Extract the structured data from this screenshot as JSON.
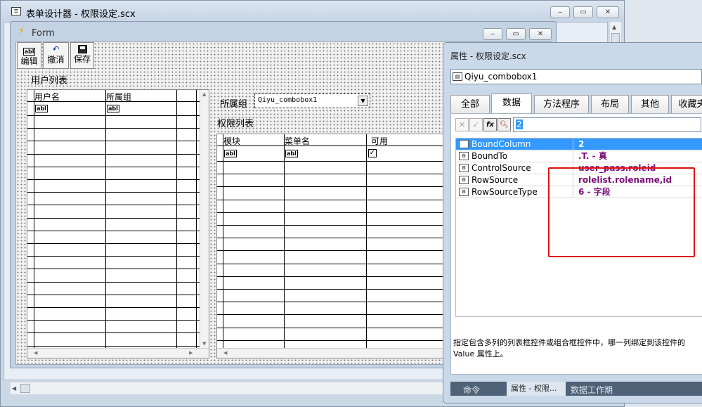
{
  "designer_window": {
    "title": "表单设计器 - 权限设定.scx",
    "controls": [
      "‒",
      "▭",
      "✕"
    ]
  },
  "form_window": {
    "title": "Form",
    "controls": [
      "‒",
      "▭",
      "✕"
    ]
  },
  "toolbar": {
    "edit_label": "编辑",
    "undo_label": "撤消",
    "save_label": "保存"
  },
  "user_list": {
    "label": "用户列表",
    "columns": [
      "用户名",
      "所属组"
    ],
    "cell_icon": "abl"
  },
  "group": {
    "label": "所属组",
    "combobox_value": "Qiyu_combobox1"
  },
  "perm_list": {
    "label": "权限列表",
    "columns": [
      "模块",
      "菜单名",
      "可用"
    ],
    "cell_icon": "abl",
    "check_mark": "✓"
  },
  "properties": {
    "title": "属性 - 权限设定.scx",
    "object_name": "Qiyu_combobox1",
    "tabs": [
      "全部",
      "数据",
      "方法程序",
      "布局",
      "其他",
      "收藏夹"
    ],
    "active_tab": "数据",
    "edit_value": "2",
    "fx_label": "fx",
    "rows": [
      {
        "name": "BoundColumn",
        "value": "2"
      },
      {
        "name": "BoundTo",
        "value": ".T. - 真"
      },
      {
        "name": "ControlSource",
        "value": "user_pass.roleid"
      },
      {
        "name": "RowSource",
        "value": "rolelist.rolename,id"
      },
      {
        "name": "RowSourceType",
        "value": "6 - 字段"
      }
    ],
    "description_line1": "指定包含多列的列表框控件或组合框控件中，哪一列绑定到该控件的",
    "description_line2": "Value 属性上。"
  },
  "bottom_tabs": [
    "命令",
    "属性 - 权限...",
    "数据工作期"
  ],
  "colors": {
    "selection": "#3399ff",
    "value_text": "#7a0f7a",
    "highlight_box": "#e01010"
  }
}
